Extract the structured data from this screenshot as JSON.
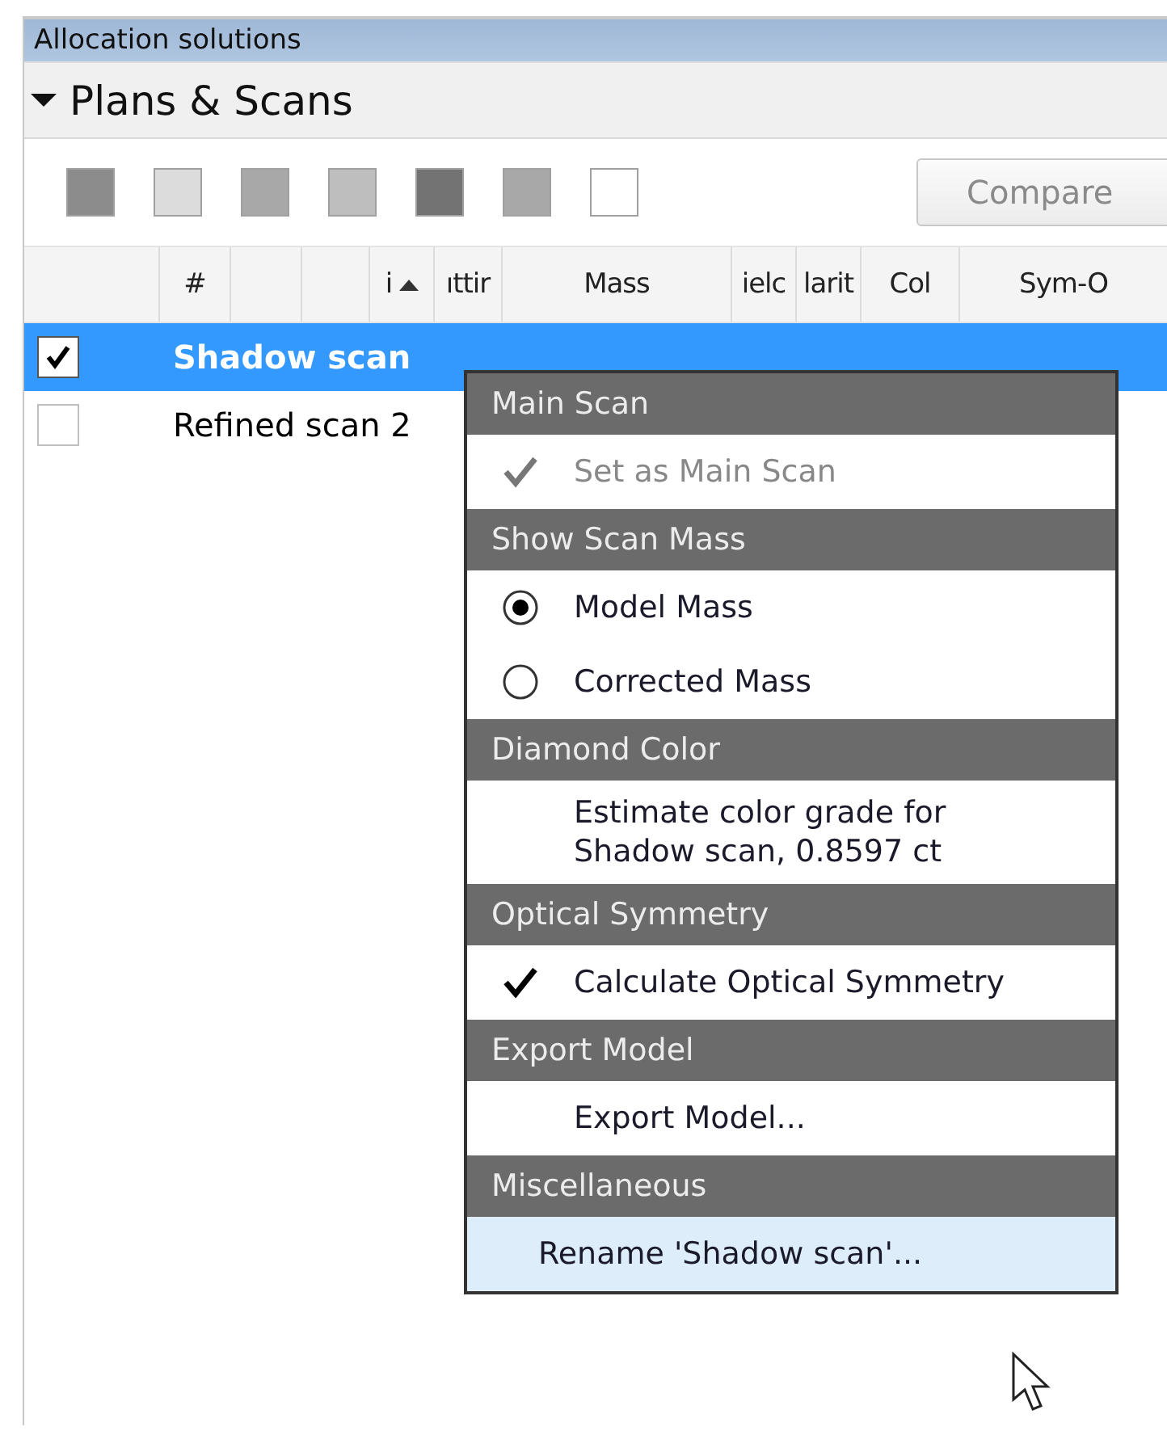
{
  "panel": {
    "title": "Allocation solutions"
  },
  "section": {
    "title": "Plans & Scans",
    "expanded": true
  },
  "toolbar": {
    "swatches": [
      {
        "color": "#8c8c8c"
      },
      {
        "color": "#dcdcdc"
      },
      {
        "color": "#a8a8a8"
      },
      {
        "color": "#bebebe"
      },
      {
        "color": "#737373"
      },
      {
        "color": "#a8a8a8"
      },
      {
        "color": "#ffffff"
      }
    ],
    "compare_button": {
      "label": "Compare",
      "disabled": true
    }
  },
  "table": {
    "columns": [
      {
        "sorted": false
      },
      {
        "label": "#",
        "sorted": false
      },
      {
        "sorted": false
      },
      {
        "sorted": false
      },
      {
        "label": "i",
        "sorted": true
      },
      {
        "label": "ıttir",
        "sorted": false
      },
      {
        "label": "Mass",
        "sorted": false
      },
      {
        "label": "ielc",
        "sorted": false
      },
      {
        "label": "larit",
        "sorted": false
      },
      {
        "label": "Col",
        "sorted": false
      },
      {
        "label": "Sym-O",
        "sorted": false
      }
    ],
    "rows": [
      {
        "name": "Shadow scan",
        "checked": true,
        "selected": true
      },
      {
        "name": "Refined scan 2",
        "checked": false,
        "selected": false
      }
    ]
  },
  "context_menu": {
    "sections": [
      {
        "header": "Main Scan",
        "items": [
          {
            "kind": "check",
            "label": "Set as Main Scan",
            "checked": true,
            "disabled": true,
            "hovered": false
          }
        ]
      },
      {
        "header": "Show Scan Mass",
        "items": [
          {
            "kind": "radio",
            "label": "Model Mass",
            "selected": true,
            "disabled": false,
            "hovered": false
          },
          {
            "kind": "radio",
            "label": "Corrected Mass",
            "selected": false,
            "disabled": false,
            "hovered": false
          }
        ]
      },
      {
        "header": "Diamond Color",
        "items": [
          {
            "kind": "plain",
            "label": "Estimate color grade for\nShadow scan, 0.8597 ct",
            "disabled": false,
            "hovered": false
          }
        ]
      },
      {
        "header": "Optical Symmetry",
        "items": [
          {
            "kind": "check",
            "label": "Calculate Optical Symmetry",
            "checked": true,
            "disabled": false,
            "hovered": false
          }
        ]
      },
      {
        "header": "Export Model",
        "items": [
          {
            "kind": "plain",
            "label": "Export Model...",
            "disabled": false,
            "hovered": false
          }
        ]
      },
      {
        "header": "Miscellaneous",
        "items": [
          {
            "kind": "action",
            "label": "Rename 'Shadow scan'...",
            "disabled": false,
            "hovered": true
          }
        ]
      }
    ]
  }
}
